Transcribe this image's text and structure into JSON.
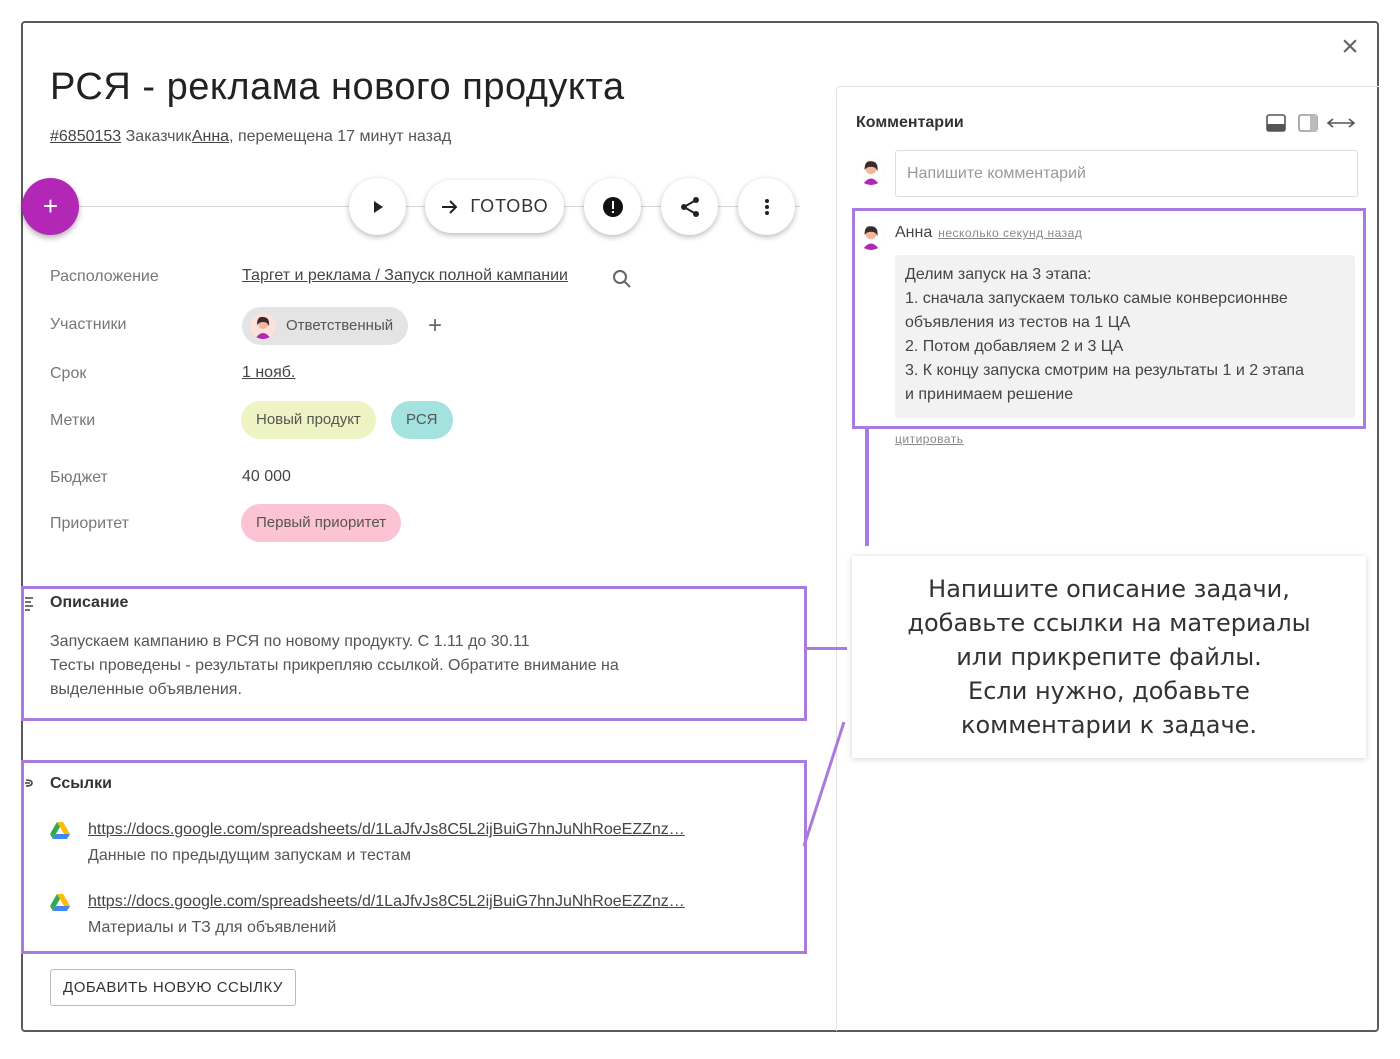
{
  "task": {
    "title": "РСЯ - реклама нового продукта",
    "id": "#6850153",
    "customer_label": "Заказчик",
    "customer_name": "Анна",
    "moved_text": ", перемещена 17 минут назад"
  },
  "toolbar": {
    "add_label": "+",
    "done_label": "ГОТОВО"
  },
  "fields": {
    "location_label": "Расположение",
    "location_value": "Таргет и реклама / Запуск полной кампании",
    "participants_label": "Участники",
    "responsible_chip": "Ответственный",
    "add_participant": "+",
    "deadline_label": "Срок",
    "deadline_value": "1 нояб.",
    "tags_label": "Метки",
    "tags": [
      {
        "label": "Новый продукт",
        "color": "#eef3c4"
      },
      {
        "label": "РСЯ",
        "color": "#a3e2de"
      }
    ],
    "budget_label": "Бюджет",
    "budget_value": "40 000",
    "priority_label": "Приоритет",
    "priority_value": "Первый приоритет",
    "priority_color": "#fbc3d3"
  },
  "description": {
    "heading": "Описание",
    "lines": [
      "Запускаем кампанию в РСЯ по новому продукту. С 1.11 до 30.11",
      "Тесты проведены - результаты прикрепляю ссылкой. Обратите внимание на",
      "выделенные объявления."
    ]
  },
  "links": {
    "heading": "Ссылки",
    "items": [
      {
        "url": "https://docs.google.com/spreadsheets/d/1LaJfvJs8C5L2ijBuiG7hnJuNhRoeEZZnz…",
        "caption": "Данные по предыдущим запускам и тестам"
      },
      {
        "url": "https://docs.google.com/spreadsheets/d/1LaJfvJs8C5L2ijBuiG7hnJuNhRoeEZZnz…",
        "caption": "Материалы и ТЗ для объявлений"
      }
    ],
    "add_button": "ДОБАВИТЬ НОВУЮ ССЫЛКУ"
  },
  "comments": {
    "title": "Комментарии",
    "input_placeholder": "Напишите комментарий",
    "items": [
      {
        "author": "Анна",
        "time": "несколько секунд назад",
        "lines": [
          "Делим запуск на 3 этапа:",
          "1. сначала запускаем только самые конверсионнве",
          "объявления из тестов на 1 ЦА",
          "2. Потом добавляем 2 и 3 ЦА",
          "3. К концу запуска смотрим на результаты 1 и 2 этапа",
          "и принимаем решение"
        ],
        "quote_label": "цитировать"
      }
    ]
  },
  "callout": {
    "lines": [
      "Напишите описание задачи,",
      "добавьте ссылки на материалы",
      "или прикрепите файлы.",
      "Если нужно, добавьте",
      "комментарии к задаче."
    ]
  },
  "colors": {
    "accent": "#b327b7",
    "highlight": "#a97be0"
  },
  "icons": [
    "close-icon",
    "plus-icon",
    "play-icon",
    "arrow-right-icon",
    "alert-icon",
    "share-icon",
    "more-vert-icon",
    "search-icon",
    "google-drive-icon",
    "avatar",
    "layout-bottom-icon",
    "layout-side-icon",
    "expand-horizontal-icon"
  ]
}
